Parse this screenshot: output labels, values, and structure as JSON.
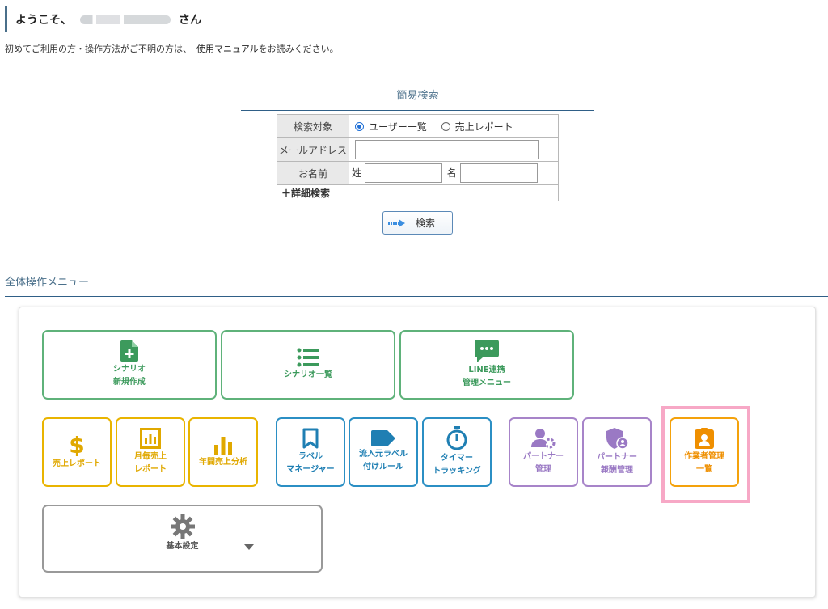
{
  "header": {
    "welcome_prefix": "ようこそ、",
    "welcome_suffix": "さん",
    "intro_text": "初めてご利用の方・操作方法がご不明の方は、",
    "manual_link": "使用マニュアル",
    "intro_end": "をお読みください。"
  },
  "search": {
    "title": "簡易検索",
    "target_label": "検索対象",
    "target_options": [
      "ユーザー一覧",
      "売上レポート"
    ],
    "target_selected": "ユーザー一覧",
    "email_label": "メールアドレス",
    "email_value": "",
    "name_label": "お名前",
    "last_name_label": "姓",
    "last_name_value": "",
    "first_name_label": "名",
    "first_name_value": "",
    "detail_link": "＋詳細検索",
    "submit_label": "検索"
  },
  "menu": {
    "title": "全体操作メニュー",
    "tiles": {
      "scenario_new": [
        "シナリオ",
        "新規作成"
      ],
      "scenario_list": [
        "シナリオ一覧"
      ],
      "line": [
        "LINE連携",
        "管理メニュー"
      ],
      "sales_report": [
        "売上レポート"
      ],
      "monthly_sales": [
        "月毎売上",
        "レポート"
      ],
      "annual_sales": [
        "年間売上分析"
      ],
      "label_manager": [
        "ラベル",
        "マネージャー"
      ],
      "inflow_label": [
        "流入元ラベル",
        "付けルール"
      ],
      "timer_tracking": [
        "タイマー",
        "トラッキング"
      ],
      "partner_manage": [
        "パートナー",
        "管理"
      ],
      "partner_reward": [
        "パートナー",
        "報酬管理"
      ],
      "worker_manage": [
        "作業者管理",
        "一覧"
      ],
      "basic_settings": [
        "基本設定"
      ]
    }
  },
  "colors": {
    "accent": "#2f5f87",
    "green": "#5fb27a",
    "yellow": "#e9b400",
    "blue": "#2b8fc4",
    "purple": "#a784c9",
    "orange": "#f4a20c",
    "highlight": "#f7a8c6"
  },
  "icons": {
    "scenario_new": "file-plus-icon",
    "scenario_list": "list-icon",
    "line": "chat-bubble-icon",
    "sales_report": "dollar-icon",
    "monthly_sales": "bar-chart-box-icon",
    "annual_sales": "bar-chart-icon",
    "label_manager": "bookmark-icon",
    "inflow_label": "tag-icon",
    "timer_tracking": "stopwatch-icon",
    "partner_manage": "user-gear-icon",
    "partner_reward": "shield-user-icon",
    "worker_manage": "id-badge-icon",
    "basic_settings": "gear-icon"
  }
}
